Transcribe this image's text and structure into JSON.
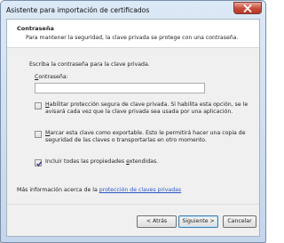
{
  "window": {
    "title": "Asistente para importación de certificados"
  },
  "header": {
    "title": "Contraseña",
    "description": "Para mantener la seguridad, la clave privada se protege con una contraseña."
  },
  "form": {
    "prompt": "Escriba la contraseña para la clave privada.",
    "password_label_hotkey": "C",
    "password_label_rest": "ontraseña:",
    "password_value": ""
  },
  "options": [
    {
      "pre": "",
      "hotkey": "H",
      "line1_rest": "abilitar protección segura de clave privada. Si habilita esta opción, se le",
      "line2": "avisará cada vez que la clave privada sea usada por una aplicación.",
      "checked": false
    },
    {
      "pre": "",
      "hotkey": "M",
      "line1_rest": "arcar esta clave como exportable. Esto le permitirá hacer una copia de",
      "line2": "seguridad de las claves o transportarlas en otro momento.",
      "checked": false
    },
    {
      "pre": "Incluir todas las propiedades ",
      "hotkey": "e",
      "line1_rest": "xtendidas.",
      "line2": "",
      "checked": true
    }
  ],
  "info": {
    "text": "Más información acerca de la ",
    "link": "protección de claves privadas"
  },
  "buttons": {
    "back": "< Atrás",
    "next_hotkey": "n",
    "next_pre": "Siguiente",
    "next_post": " >",
    "cancel": "Cancelar"
  }
}
